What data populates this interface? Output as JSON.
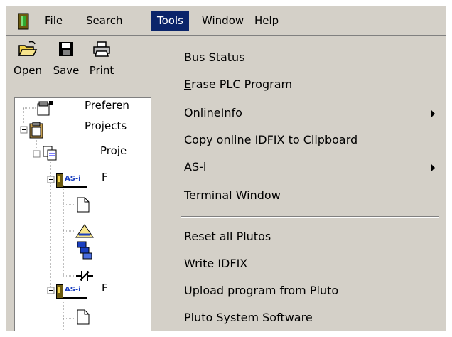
{
  "menubar": {
    "items": [
      {
        "label": "File"
      },
      {
        "label": "Search"
      },
      {
        "label": "Tools"
      },
      {
        "label": "Window"
      },
      {
        "label": "Help"
      }
    ]
  },
  "toolbar": {
    "open_label": "Open",
    "save_label": "Save",
    "print_label": "Print"
  },
  "tree": {
    "preferences_label": "Preferen",
    "projects_label": "Projects",
    "project_label": "Proje",
    "asi_badge": "AS-i",
    "asi_node_1_suffix": "F",
    "asi_node_2_suffix": "F"
  },
  "tools_menu": {
    "items": [
      {
        "label": "Bus Status"
      },
      {
        "label": "Erase PLC Program"
      },
      {
        "label": "OnlineInfo"
      },
      {
        "label": "Copy online IDFIX to Clipboard"
      },
      {
        "label": "AS-i"
      },
      {
        "label": "Terminal Window"
      },
      {
        "label": "Reset all Plutos"
      },
      {
        "label": "Write IDFIX"
      },
      {
        "label": "Upload program from Pluto"
      },
      {
        "label": "Pluto System Software"
      }
    ]
  },
  "colors": {
    "menu_face": "#d4d0c8",
    "highlight": "#0a246a",
    "window_bg": "#ffffff"
  }
}
